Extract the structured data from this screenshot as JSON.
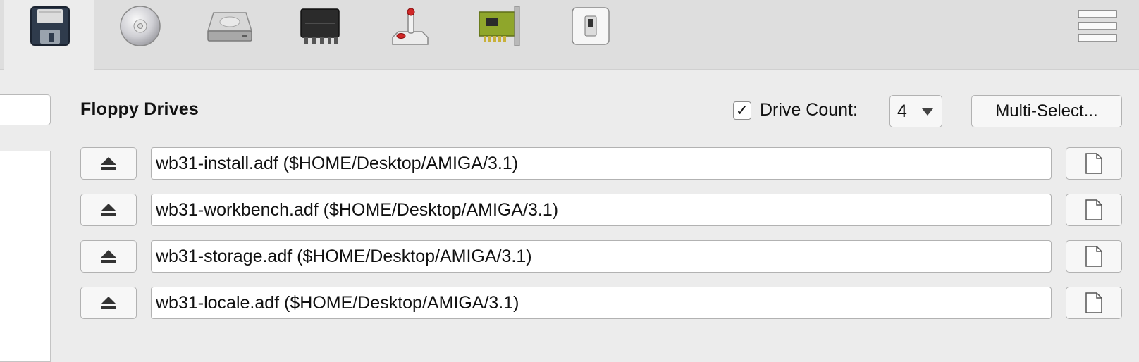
{
  "toolbar": {
    "icons": [
      {
        "name": "floppy-icon",
        "selected": true
      },
      {
        "name": "cd-icon",
        "selected": false
      },
      {
        "name": "hard-drive-icon",
        "selected": false
      },
      {
        "name": "memory-chip-icon",
        "selected": false
      },
      {
        "name": "joystick-icon",
        "selected": false
      },
      {
        "name": "expansion-card-icon",
        "selected": false
      },
      {
        "name": "switch-icon",
        "selected": false
      },
      {
        "name": "menu-icon",
        "selected": false
      }
    ]
  },
  "floppy": {
    "title": "Floppy Drives",
    "drive_count_checked": true,
    "drive_count_label": "Drive Count:",
    "drive_count_value": "4",
    "multi_select_label": "Multi-Select...",
    "drives": [
      {
        "path": "wb31-install.adf ($HOME/Desktop/AMIGA/3.1)"
      },
      {
        "path": "wb31-workbench.adf ($HOME/Desktop/AMIGA/3.1)"
      },
      {
        "path": "wb31-storage.adf ($HOME/Desktop/AMIGA/3.1)"
      },
      {
        "path": "wb31-locale.adf ($HOME/Desktop/AMIGA/3.1)"
      }
    ]
  },
  "colors": {
    "background": "#ececec",
    "toolbar": "#dedede",
    "pcb_green": "#8fa62b"
  }
}
